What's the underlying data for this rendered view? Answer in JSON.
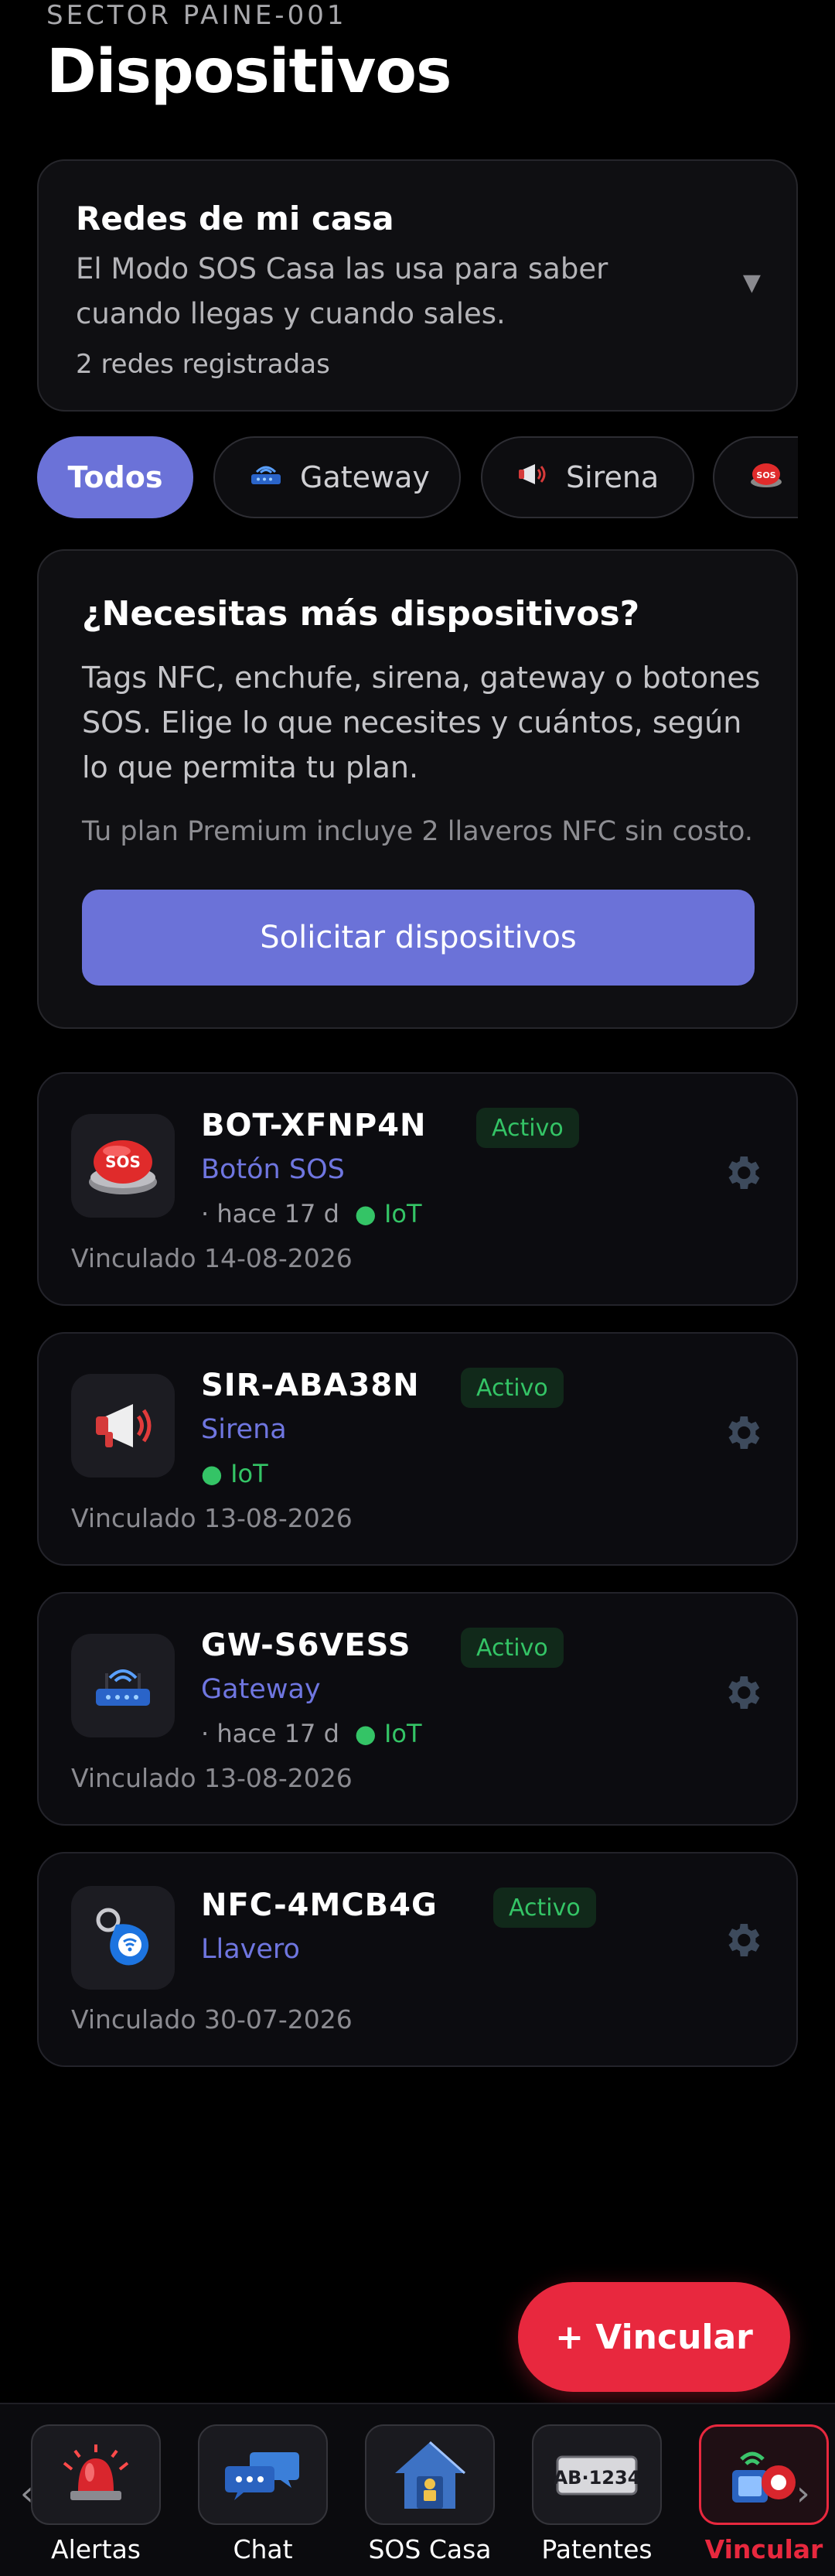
{
  "header": {
    "sector": "SECTOR PAINE-001",
    "title": "Dispositivos"
  },
  "redes": {
    "title": "Redes de mi casa",
    "description": "El Modo SOS Casa las usa para saber cuando llegas y cuando sales.",
    "count": "2 redes registradas",
    "chevron_icon": "chevron-down-icon"
  },
  "filters": [
    {
      "label": "Todos",
      "icon": "",
      "active": true
    },
    {
      "label": "Gateway",
      "icon": "router-icon",
      "active": false
    },
    {
      "label": "Sirena",
      "icon": "megaphone-icon",
      "active": false
    },
    {
      "label": "",
      "icon": "sos-button-icon",
      "active": false
    }
  ],
  "promo": {
    "title": "¿Necesitas más dispositivos?",
    "description": "Tags NFC, enchufe, sirena, gateway o botones SOS. Elige lo que necesites y cuántos, según lo que permita tu plan.",
    "note": "Tu plan Premium incluye 2 llaveros NFC sin costo.",
    "button": "Solicitar dispositivos"
  },
  "devices": [
    {
      "name": "BOT-XFNP4N",
      "status": "Activo",
      "type": "Botón SOS",
      "last_seen": "· hace 17 d",
      "iot": "● IoT",
      "linked": "Vinculado 14-08-2026",
      "icon": "sos-button-icon"
    },
    {
      "name": "SIR-ABA38N",
      "status": "Activo",
      "type": "Sirena",
      "last_seen": "",
      "iot": "● IoT",
      "linked": "Vinculado 13-08-2026",
      "icon": "megaphone-icon"
    },
    {
      "name": "GW-S6VESS",
      "status": "Activo",
      "type": "Gateway",
      "last_seen": "· hace 17 d",
      "iot": "● IoT",
      "linked": "Vinculado 13-08-2026",
      "icon": "router-icon"
    },
    {
      "name": "NFC-4MCB4G",
      "status": "Activo",
      "type": "Llavero",
      "last_seen": "",
      "iot": "",
      "linked": "Vinculado 30-07-2026",
      "icon": "nfc-keychain-icon"
    }
  ],
  "fab": {
    "label": "+ Vincular"
  },
  "nav": [
    {
      "label": "Alertas",
      "icon": "siren-light-icon",
      "active": false
    },
    {
      "label": "Chat",
      "icon": "chat-bubbles-icon",
      "active": false
    },
    {
      "label": "SOS Casa",
      "icon": "house-icon",
      "active": false
    },
    {
      "label": "Patentes",
      "icon": "license-plate-icon",
      "active": false
    },
    {
      "label": "Vincular",
      "icon": "link-devices-icon",
      "active": true
    }
  ],
  "plate_text": "AB·1234",
  "colors": {
    "accent": "#6b72d8",
    "danger": "#e8283e",
    "success": "#34c466",
    "background": "#000000"
  }
}
